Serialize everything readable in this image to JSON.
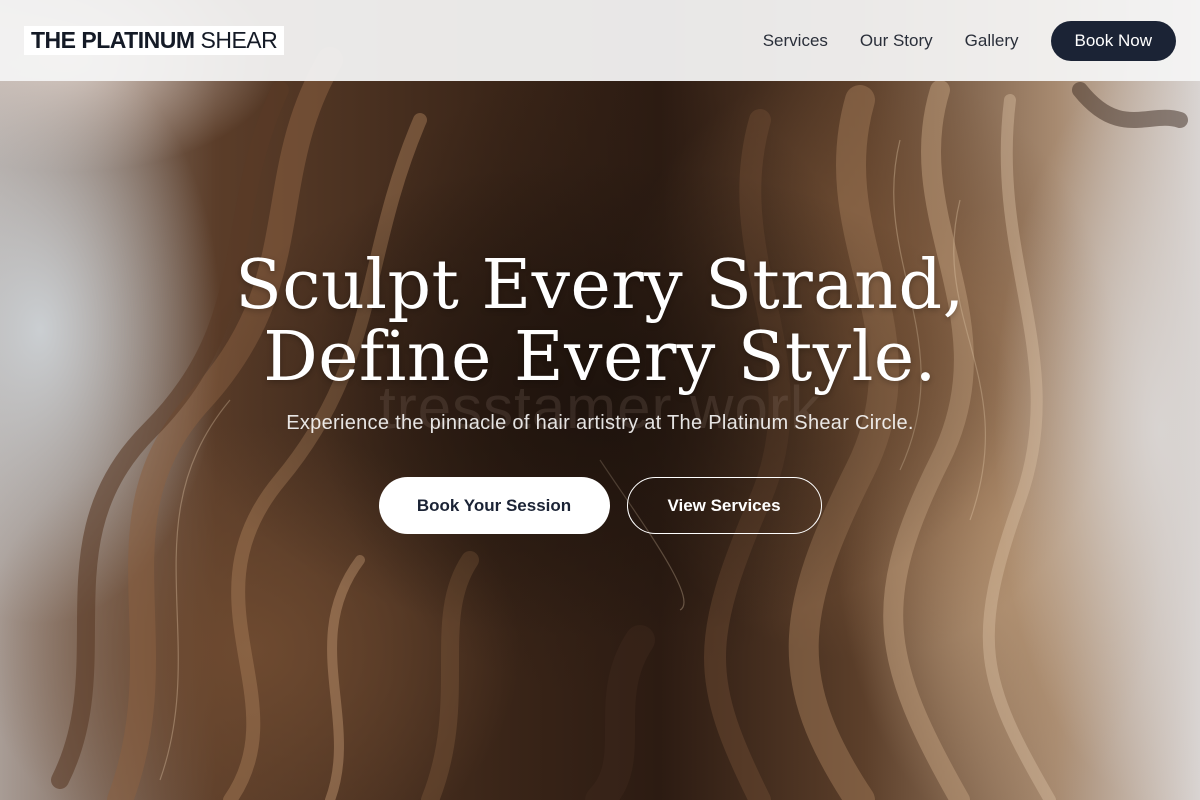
{
  "header": {
    "logo_strong": "THE PLATINUM",
    "logo_light": "SHEAR",
    "nav": [
      {
        "label": "Services"
      },
      {
        "label": "Our Story"
      },
      {
        "label": "Gallery"
      }
    ],
    "cta_label": "Book Now"
  },
  "hero": {
    "title_line1": "Sculpt Every Strand,",
    "title_line2": "Define Every Style.",
    "ghost_text": "tresstamer work",
    "subtitle": "Experience the pinnacle of hair artistry at The Platinum Shear Circle.",
    "primary_button": "Book Your Session",
    "secondary_button": "View Services"
  },
  "colors": {
    "header_bg": "#f4f4f4",
    "brand_navy": "#1b2335",
    "text_white": "#ffffff"
  }
}
